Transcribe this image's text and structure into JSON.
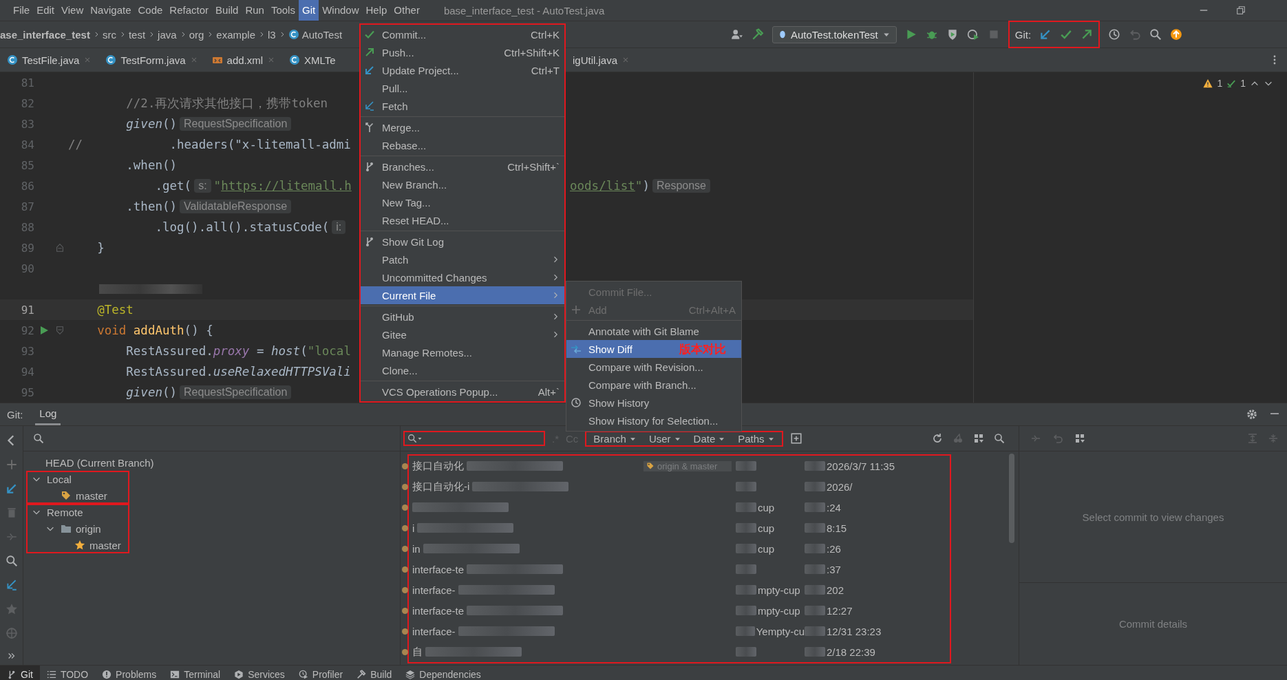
{
  "menubar": {
    "items": [
      {
        "label": "File",
        "selected": false
      },
      {
        "label": "Edit",
        "selected": false
      },
      {
        "label": "View",
        "selected": false
      },
      {
        "label": "Navigate",
        "selected": false
      },
      {
        "label": "Code",
        "selected": false
      },
      {
        "label": "Refactor",
        "selected": false
      },
      {
        "label": "Build",
        "selected": false
      },
      {
        "label": "Run",
        "selected": false
      },
      {
        "label": "Tools",
        "selected": false
      },
      {
        "label": "Git",
        "selected": true
      },
      {
        "label": "Window",
        "selected": false
      },
      {
        "label": "Help",
        "selected": false
      },
      {
        "label": "Other",
        "selected": false
      }
    ],
    "title": "base_interface_test - AutoTest.java"
  },
  "breadcrumb": [
    "ase_interface_test",
    "src",
    "test",
    "java",
    "org",
    "example",
    "l3",
    "AutoTest"
  ],
  "toolbar": {
    "run_config": "AutoTest.tokenTest",
    "git_label": "Git:",
    "git_highlighted": true
  },
  "tabs": [
    {
      "label": "TestFile.java",
      "kind": "java",
      "closable": true
    },
    {
      "label": "TestForm.java",
      "kind": "java",
      "closable": true
    },
    {
      "label": "add.xml",
      "kind": "xml",
      "closable": true
    },
    {
      "label": "XMLTe",
      "kind": "java",
      "closable": false
    },
    {
      "label": "igUtil.java",
      "kind": "plain",
      "closable": true
    }
  ],
  "inspections": {
    "warnings": "1",
    "weak_warnings": "1"
  },
  "editor": {
    "lines": [
      {
        "number": "81"
      },
      {
        "number": "82",
        "tokens": [
          {
            "kind": "comment",
            "text": "        //2.再次请求其他接口，携带token"
          }
        ]
      },
      {
        "number": "83",
        "tokens": [
          {
            "kind": "call",
            "text": "        given"
          },
          {
            "kind": "plain",
            "text": "()"
          },
          {
            "kind": "hint",
            "text": "RequestSpecification"
          }
        ]
      },
      {
        "number": "84",
        "tokens": [
          {
            "kind": "comment",
            "text": "//"
          },
          {
            "kind": "plain",
            "text": "            .headers(\"x-litemall-admi"
          }
        ]
      },
      {
        "number": "85",
        "tokens": [
          {
            "kind": "plain",
            "text": "        .when()"
          }
        ]
      },
      {
        "number": "86",
        "tokens": [
          {
            "kind": "plain",
            "text": "            .get("
          },
          {
            "kind": "hint",
            "text": "s:"
          },
          {
            "kind": "string",
            "text": "\""
          },
          {
            "kind": "url",
            "text": "https://litemall.h"
          }
        ],
        "tail": [
          {
            "kind": "url",
            "text": "oods/list"
          },
          {
            "kind": "string",
            "text": "\""
          },
          {
            "kind": "plain",
            "text": ")"
          },
          {
            "kind": "hint",
            "text": "Response"
          }
        ]
      },
      {
        "number": "87",
        "tokens": [
          {
            "kind": "plain",
            "text": "        .then()"
          },
          {
            "kind": "hint",
            "text": "ValidatableResponse"
          }
        ]
      },
      {
        "number": "88",
        "tokens": [
          {
            "kind": "plain",
            "text": "            .log().all().statusCode("
          },
          {
            "kind": "hint",
            "text": "i:"
          }
        ]
      },
      {
        "number": "89",
        "fold_end": true,
        "tokens": [
          {
            "kind": "plain",
            "text": "    }"
          }
        ]
      },
      {
        "number": "90"
      },
      {
        "kind": "redacted"
      },
      {
        "number": "91",
        "current": true,
        "tokens": [
          {
            "kind": "annotation",
            "text": "    @Test"
          }
        ]
      },
      {
        "number": "92",
        "run": true,
        "fold_start": true,
        "tokens": [
          {
            "kind": "keyword",
            "text": "    void"
          },
          {
            "kind": "fn",
            "text": " addAuth"
          },
          {
            "kind": "plain",
            "text": "() {"
          }
        ]
      },
      {
        "number": "93",
        "tokens": [
          {
            "kind": "plain",
            "text": "        RestAssured."
          },
          {
            "kind": "field",
            "text": "proxy"
          },
          {
            "kind": "plain",
            "text": " = "
          },
          {
            "kind": "call",
            "text": "host"
          },
          {
            "kind": "plain",
            "text": "("
          },
          {
            "kind": "string",
            "text": "\"local"
          }
        ]
      },
      {
        "number": "94",
        "tokens": [
          {
            "kind": "plain",
            "text": "        RestAssured."
          },
          {
            "kind": "call",
            "text": "useRelaxedHTTPSVali"
          }
        ]
      },
      {
        "number": "95",
        "tokens": [
          {
            "kind": "call",
            "text": "        given"
          },
          {
            "kind": "plain",
            "text": "()"
          },
          {
            "kind": "hint",
            "text": "RequestSpecification"
          }
        ]
      }
    ]
  },
  "git_menu": {
    "highlighted": true,
    "items": [
      {
        "kind": "item",
        "label": "Commit...",
        "shortcut": "Ctrl+K",
        "selected": false
      },
      {
        "kind": "item",
        "label": "Push...",
        "shortcut": "Ctrl+Shift+K",
        "selected": false
      },
      {
        "kind": "item",
        "label": "Update Project...",
        "shortcut": "Ctrl+T",
        "selected": false
      },
      {
        "kind": "item",
        "label": "Pull...",
        "selected": false
      },
      {
        "kind": "item",
        "label": "Fetch",
        "selected": false
      },
      {
        "kind": "separator"
      },
      {
        "kind": "item",
        "label": "Merge...",
        "selected": false
      },
      {
        "kind": "item",
        "label": "Rebase...",
        "selected": false
      },
      {
        "kind": "separator"
      },
      {
        "kind": "item",
        "label": "Branches...",
        "shortcut": "Ctrl+Shift+`",
        "selected": false
      },
      {
        "kind": "item",
        "label": "New Branch...",
        "selected": false
      },
      {
        "kind": "item",
        "label": "New Tag...",
        "selected": false
      },
      {
        "kind": "item",
        "label": "Reset HEAD...",
        "selected": false
      },
      {
        "kind": "separator"
      },
      {
        "kind": "item",
        "label": "Show Git Log",
        "selected": false
      },
      {
        "kind": "submenu",
        "label": "Patch",
        "selected": false
      },
      {
        "kind": "submenu",
        "label": "Uncommitted Changes",
        "selected": false
      },
      {
        "kind": "submenu",
        "label": "Current File",
        "selected": true
      },
      {
        "kind": "separator"
      },
      {
        "kind": "submenu",
        "label": "GitHub",
        "selected": false
      },
      {
        "kind": "submenu",
        "label": "Gitee",
        "selected": false
      },
      {
        "kind": "item",
        "label": "Manage Remotes...",
        "selected": false
      },
      {
        "kind": "item",
        "label": "Clone...",
        "selected": false
      },
      {
        "kind": "separator"
      },
      {
        "kind": "item",
        "label": "VCS Operations Popup...",
        "shortcut": "Alt+`",
        "selected": false
      }
    ]
  },
  "current_file_menu": {
    "items": [
      {
        "kind": "item",
        "label": "Commit File...",
        "disabled": true,
        "selected": false
      },
      {
        "kind": "item",
        "label": "Add",
        "shortcut": "Ctrl+Alt+A",
        "disabled": true,
        "selected": false
      },
      {
        "kind": "separator"
      },
      {
        "kind": "item",
        "label": "Annotate with Git Blame",
        "disabled": false,
        "selected": false
      },
      {
        "kind": "item",
        "label": "Show Diff",
        "note": "版本对比",
        "disabled": false,
        "selected": true
      },
      {
        "kind": "item",
        "label": "Compare with Revision...",
        "disabled": false,
        "selected": false
      },
      {
        "kind": "item",
        "label": "Compare with Branch...",
        "disabled": false,
        "selected": false
      },
      {
        "kind": "item",
        "label": "Show History",
        "disabled": false,
        "selected": false
      },
      {
        "kind": "item",
        "label": "Show History for Selection...",
        "disabled": false,
        "selected": false
      }
    ]
  },
  "tool_window": {
    "label": "Git:",
    "tabs": [
      {
        "label": "Log",
        "selected": true
      }
    ]
  },
  "branches": {
    "head": "HEAD (Current Branch)",
    "groups": [
      {
        "label": "Local",
        "expanded": true,
        "highlighted": true,
        "children": [
          {
            "label": "master",
            "kind": "local"
          }
        ]
      },
      {
        "label": "Remote",
        "expanded": true,
        "highlighted": true,
        "children": [
          {
            "label": "origin",
            "kind": "remote",
            "expanded": true,
            "children": [
              {
                "label": "master",
                "kind": "favorite"
              }
            ]
          }
        ]
      }
    ]
  },
  "log": {
    "search_highlighted": true,
    "regex": ".*",
    "case": "Cc",
    "filters": [
      "Branch",
      "User",
      "Date",
      "Paths"
    ],
    "filters_highlighted": true,
    "list_highlighted": true,
    "commits": [
      {
        "subject": "接口自动化",
        "refs": "origin & master",
        "date": "2026/3/7 11:35"
      },
      {
        "subject": "接口自动化-i",
        "date": "2026/"
      },
      {
        "author": "cup",
        "date": ":24"
      },
      {
        "subject": "i",
        "author": "cup",
        "date": "8:15"
      },
      {
        "subject": "in",
        "author": "cup",
        "date": ":26"
      },
      {
        "subject": "interface-te",
        "date": ":37"
      },
      {
        "subject": "interface-",
        "author": "mpty-cup",
        "date": "202"
      },
      {
        "subject": "interface-te",
        "author": "mpty-cup",
        "date": "12:27"
      },
      {
        "subject": "interface-",
        "author": "Yempty-cu",
        "date": "12/31 23:23"
      },
      {
        "subject": "自",
        "date": "2/18 22:39"
      }
    ]
  },
  "details": {
    "changes_hint": "Select commit to view changes",
    "details_hint": "Commit details"
  },
  "tool_stripe": [
    {
      "label": "Git",
      "kind": "git",
      "selected": true
    },
    {
      "label": "TODO",
      "kind": "todo",
      "selected": false
    },
    {
      "label": "Problems",
      "kind": "problems",
      "selected": false
    },
    {
      "label": "Terminal",
      "kind": "terminal",
      "selected": false
    },
    {
      "label": "Services",
      "kind": "services",
      "selected": false
    },
    {
      "label": "Profiler",
      "kind": "profiler",
      "selected": false
    },
    {
      "label": "Build",
      "kind": "build",
      "selected": false
    },
    {
      "label": "Dependencies",
      "kind": "dependencies",
      "selected": false
    }
  ]
}
